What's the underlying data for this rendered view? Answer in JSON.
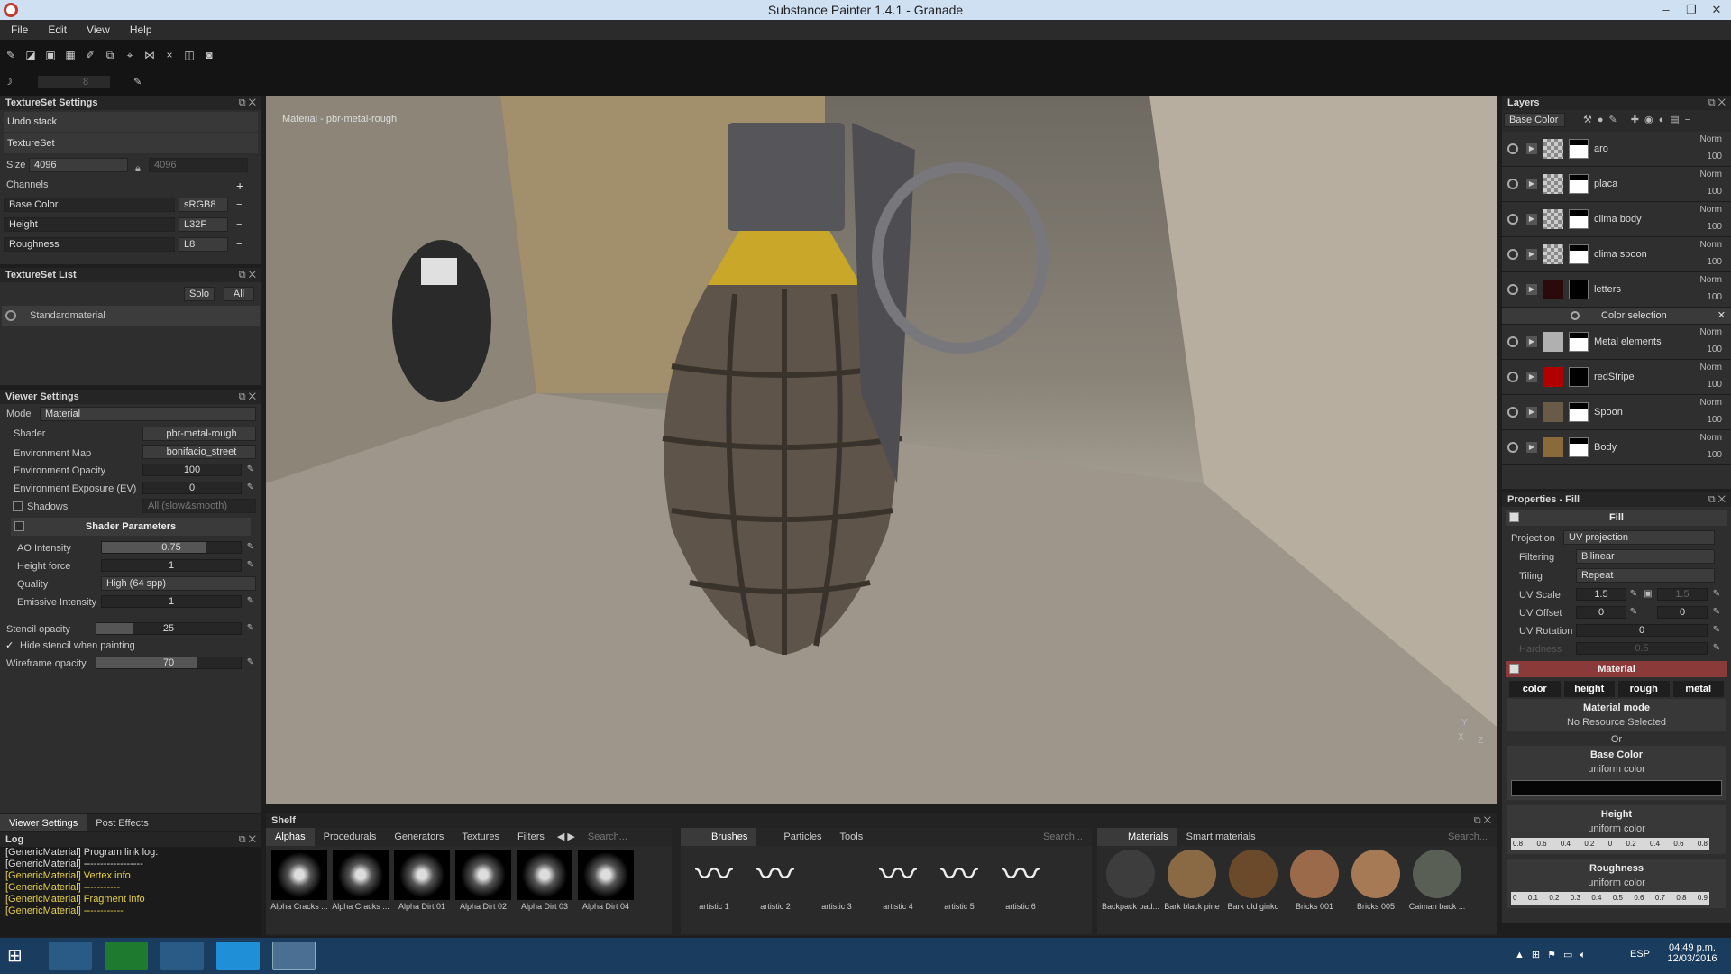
{
  "window": {
    "title": "Substance Painter 1.4.1 - Granade",
    "min": "–",
    "max": "❐",
    "close": "✕"
  },
  "menu": [
    "File",
    "Edit",
    "View",
    "Help"
  ],
  "toolbar2": {
    "brush_size": "8"
  },
  "texture_set_settings": {
    "title": "TextureSet Settings",
    "undo": "Undo stack",
    "textureset": "TextureSet",
    "size_label": "Size",
    "size_w": "4096",
    "size_h": "4096",
    "channels_label": "Channels",
    "channels": [
      {
        "name": "Base Color",
        "format": "sRGB8"
      },
      {
        "name": "Height",
        "format": "L32F"
      },
      {
        "name": "Roughness",
        "format": "L8"
      }
    ]
  },
  "texture_set_list": {
    "title": "TextureSet List",
    "solo": "Solo",
    "all": "All",
    "item": "Standardmaterial"
  },
  "viewer_settings": {
    "title": "Viewer Settings",
    "mode_label": "Mode",
    "mode": "Material",
    "shader_label": "Shader",
    "shader": "pbr-metal-rough",
    "env_label": "Environment Map",
    "env": "bonifacio_street",
    "env_op_label": "Environment Opacity",
    "env_op": "100",
    "env_exp_label": "Environment Exposure (EV)",
    "env_exp": "0",
    "shadows_label": "Shadows",
    "shadows": "All (slow&smooth)",
    "shader_params": "Shader Parameters",
    "ao_label": "AO Intensity",
    "ao": "0.75",
    "hf_label": "Height force",
    "hf": "1",
    "quality_label": "Quality",
    "quality": "High (64 spp)",
    "emissive_label": "Emissive Intensity",
    "emissive": "1",
    "stencil_label": "Stencil opacity",
    "stencil": "25",
    "hide_stencil": "Hide stencil when painting",
    "wire_label": "Wireframe opacity",
    "wire": "70",
    "ao_level": 0.75,
    "stencil_level": 0.25,
    "wire_level": 0.7
  },
  "bottom_tabs": [
    "Viewer Settings",
    "Post Effects"
  ],
  "log": {
    "title": "Log",
    "lines": [
      "[GenericMaterial] Program link log:",
      "[GenericMaterial] ------------------",
      "[GenericMaterial] Vertex info",
      "[GenericMaterial] -----------",
      "[GenericMaterial] Fragment info",
      "[GenericMaterial] ------------"
    ]
  },
  "viewport": {
    "label": "Material - pbr-metal-rough",
    "axis_y": "Y",
    "axis_x": "X",
    "axis_z": "Z"
  },
  "layers": {
    "title": "Layers",
    "channel": "Base Color",
    "blend": "Norm",
    "opacity": "100",
    "items": [
      {
        "name": "aro",
        "color": "#ffffff"
      },
      {
        "name": "placa",
        "color": "#ffffff"
      },
      {
        "name": "clima body",
        "color": "#ffffff"
      },
      {
        "name": "clima spoon",
        "color": "#ffffff"
      },
      {
        "name": "letters",
        "color": "#2a0a0a"
      },
      {
        "name": "Metal elements",
        "color": "#b0b0b0"
      },
      {
        "name": "redStripe",
        "color": "#b00000"
      },
      {
        "name": "Spoon",
        "color": "#6a5a48"
      },
      {
        "name": "Body",
        "color": "#8a6a3a"
      }
    ],
    "sub": "Color selection",
    "sub_close": "✕"
  },
  "properties": {
    "title": "Properties - Fill",
    "fill": "Fill",
    "projection_label": "Projection",
    "projection": "UV projection",
    "filtering_label": "Filtering",
    "filtering": "Bilinear",
    "tiling_label": "Tiling",
    "tiling": "Repeat",
    "uvscale_label": "UV Scale",
    "uvscale": "1.5",
    "uvscale2": "1.5",
    "uvoffset_label": "UV Offset",
    "uvoffset": "0",
    "uvoffset2": "0",
    "uvrot_label": "UV Rotation",
    "uvrot": "0",
    "hardness_label": "Hardness",
    "hardness": "0.5",
    "material": "Material",
    "mat_tabs": [
      "color",
      "height",
      "rough",
      "metal"
    ],
    "mat_mode": "Material mode",
    "no_res": "No Resource Selected",
    "or": "Or",
    "base_color": "Base Color",
    "uniform": "uniform color",
    "height": "Height",
    "roughness": "Roughness",
    "height_ticks": [
      "0.8",
      "0.6",
      "0.4",
      "0.2",
      "0",
      "0.2",
      "0.4",
      "0.6",
      "0.8"
    ],
    "rough_ticks": [
      "0",
      "0.1",
      "0.2",
      "0.3",
      "0.4",
      "0.5",
      "0.6",
      "0.7",
      "0.8",
      "0.9"
    ]
  },
  "shelf": {
    "title": "Shelf",
    "tabs": [
      "Alphas",
      "Procedurals",
      "Generators",
      "Textures",
      "Filters"
    ],
    "search": "Search...",
    "alphas": [
      "Alpha Cracks ...",
      "Alpha Cracks ...",
      "Alpha Dirt 01",
      "Alpha Dirt 02",
      "Alpha Dirt 03",
      "Alpha Dirt 04"
    ],
    "brush_tabs": [
      "Brushes",
      "Particles",
      "Tools"
    ],
    "brushes": [
      "artistic 1",
      "artistic 2",
      "artistic 3",
      "artistic 4",
      "artistic 5",
      "artistic 6"
    ],
    "mat_tabs": [
      "Materials",
      "Smart materials"
    ],
    "materials": [
      "Backpack pad...",
      "Bark black pine",
      "Bark old ginko",
      "Bricks 001",
      "Bricks 005",
      "Caiman back ..."
    ]
  },
  "taskbar": {
    "time": "04:49 p.m.",
    "date": "12/03/2016",
    "lang": "ESP"
  }
}
